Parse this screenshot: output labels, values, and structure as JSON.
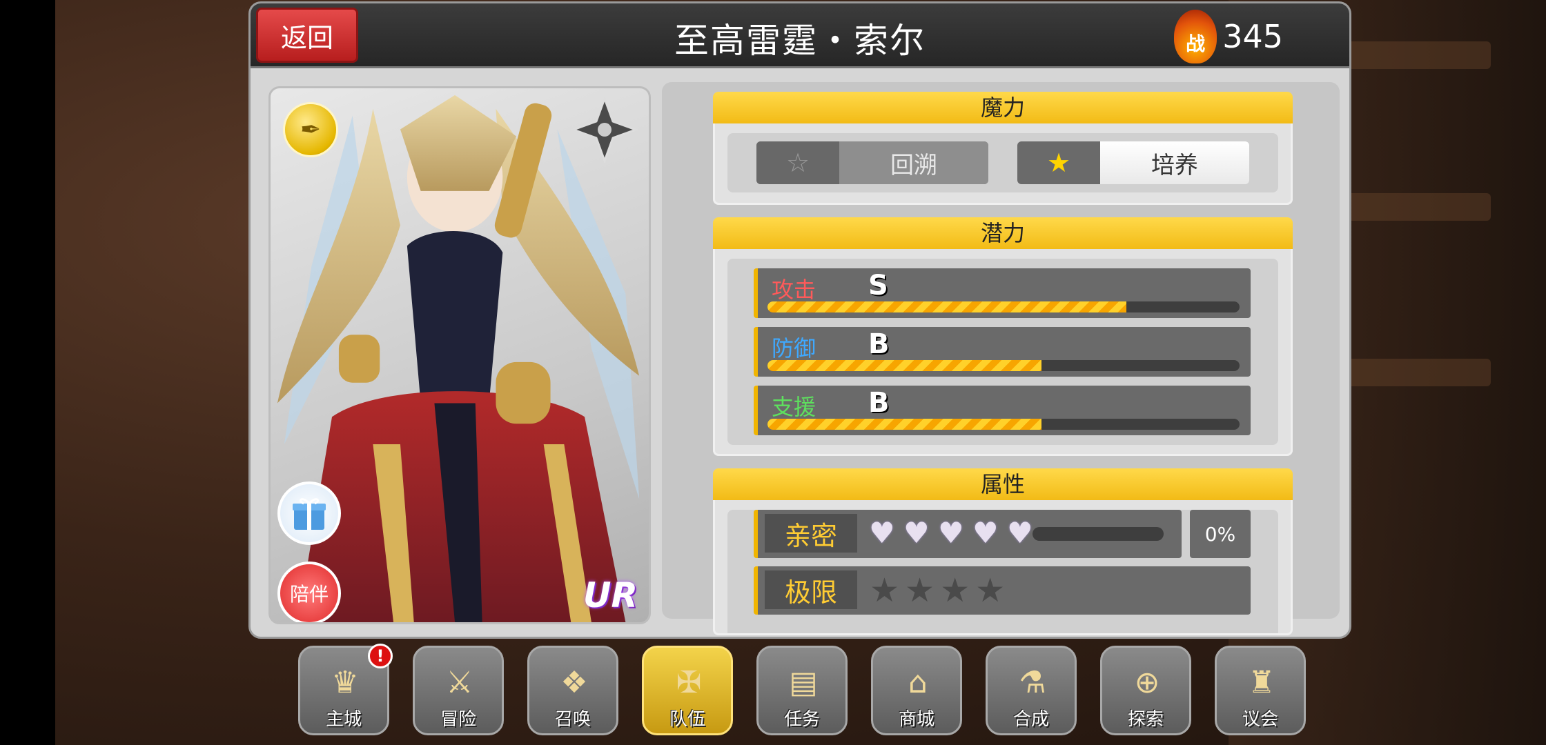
{
  "header": {
    "back_label": "返回",
    "title": "至高雷霆・索尔",
    "power_icon_label": "战",
    "power_value": "345"
  },
  "card": {
    "weapon_icon": "pen-nib-icon",
    "element_icon": "shuriken-icon",
    "gift_icon": "gift-box-icon",
    "accompany_label": "陪伴",
    "rarity": "UR"
  },
  "mana": {
    "title": "魔力",
    "regress_label": "回溯",
    "train_label": "培养"
  },
  "potential": {
    "title": "潜力",
    "stats": [
      {
        "label": "攻击",
        "grade": "S",
        "fill": 0.76,
        "color": "#ff5a5a"
      },
      {
        "label": "防御",
        "grade": "B",
        "fill": 0.58,
        "color": "#3fa9ff"
      },
      {
        "label": "支援",
        "grade": "B",
        "fill": 0.58,
        "color": "#5ee05e"
      }
    ]
  },
  "attributes": {
    "title": "属性",
    "intimacy_label": "亲密",
    "intimacy_hearts": 5,
    "intimacy_fill": 0.0,
    "intimacy_percent": "0%",
    "limit_label": "极限",
    "limit_stars": 4
  },
  "nav": [
    {
      "label": "主城",
      "icon": "castle-crown-icon",
      "badge": "!"
    },
    {
      "label": "冒险",
      "icon": "crossed-swords-icon"
    },
    {
      "label": "召唤",
      "icon": "summon-card-icon"
    },
    {
      "label": "队伍",
      "icon": "winged-shield-icon",
      "active": true
    },
    {
      "label": "任务",
      "icon": "quest-book-icon"
    },
    {
      "label": "商城",
      "icon": "shop-tent-icon"
    },
    {
      "label": "合成",
      "icon": "potion-flask-icon"
    },
    {
      "label": "探索",
      "icon": "compass-icon"
    },
    {
      "label": "议会",
      "icon": "council-crest-icon"
    }
  ]
}
